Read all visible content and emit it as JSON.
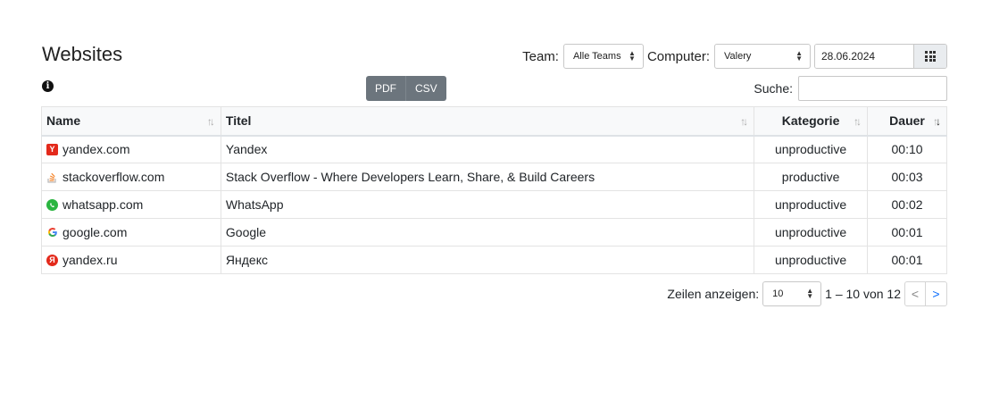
{
  "page": {
    "title": "Websites"
  },
  "filters": {
    "team_label": "Team:",
    "team_value": "Alle Teams",
    "computer_label": "Computer:",
    "computer_value": "Valery",
    "date_value": "28.06.2024"
  },
  "export": {
    "pdf_label": "PDF",
    "csv_label": "CSV"
  },
  "search": {
    "label": "Suche:",
    "value": ""
  },
  "table": {
    "headers": {
      "name": "Name",
      "title": "Titel",
      "category": "Kategorie",
      "duration": "Dauer"
    },
    "rows": [
      {
        "favicon": "yandex-icon",
        "name": "yandex.com",
        "title": "Yandex",
        "category": "unproductive",
        "duration": "00:10"
      },
      {
        "favicon": "stackoverflow-icon",
        "name": "stackoverflow.com",
        "title": "Stack Overflow - Where Developers Learn, Share, & Build Careers",
        "category": "productive",
        "duration": "00:03"
      },
      {
        "favicon": "whatsapp-icon",
        "name": "whatsapp.com",
        "title": "WhatsApp",
        "category": "unproductive",
        "duration": "00:02"
      },
      {
        "favicon": "google-icon",
        "name": "google.com",
        "title": "Google",
        "category": "unproductive",
        "duration": "00:01"
      },
      {
        "favicon": "yandex-ru-icon",
        "name": "yandex.ru",
        "title": "Яндекс",
        "category": "unproductive",
        "duration": "00:01"
      }
    ]
  },
  "pagination": {
    "rows_label": "Zeilen anzeigen:",
    "rows_value": "10",
    "range": "1 – 10 von 12",
    "prev": "<",
    "next": ">"
  },
  "colors": {
    "export_bg": "#6c757d",
    "link": "#0d6efd",
    "header_bg": "#f8f9fa"
  }
}
